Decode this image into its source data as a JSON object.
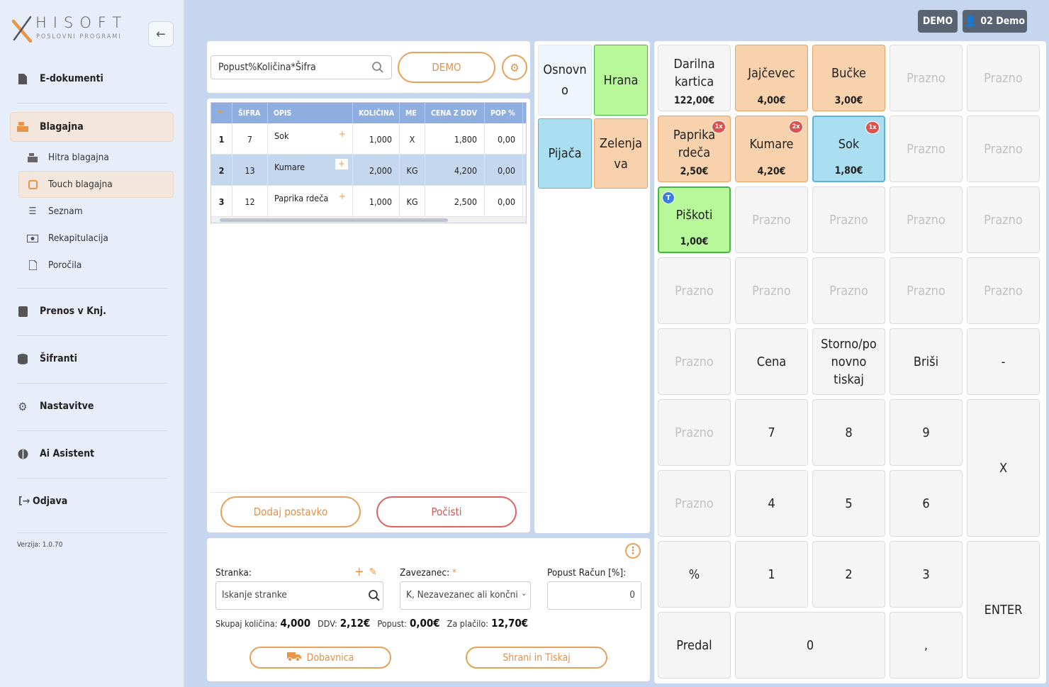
{
  "brand": {
    "name": "HISOFT",
    "tagline": "POSLOVNI PROGRAMI",
    "x_color": "#e8944a"
  },
  "topbar": {
    "env_badge": "DEMO",
    "user": "02 Demo"
  },
  "sidebar": {
    "items": [
      {
        "label": "E-dokumenti",
        "icon": "document-icon"
      },
      {
        "label": "Blagajna",
        "icon": "cash-register-icon",
        "active": true
      },
      {
        "label": "Prenos v Knj.",
        "icon": "book-icon"
      },
      {
        "label": "Šifranti",
        "icon": "database-icon"
      },
      {
        "label": "Nastavitve",
        "icon": "gear-icon"
      },
      {
        "label": "Ai Asistent",
        "icon": "brain-icon"
      },
      {
        "label": "Odjava",
        "icon": "logout-icon"
      }
    ],
    "subitems": [
      {
        "label": "Hitra blagajna",
        "icon": "register-icon"
      },
      {
        "label": "Touch blagajna",
        "icon": "tablet-icon",
        "active": true
      },
      {
        "label": "Seznam",
        "icon": "list-icon"
      },
      {
        "label": "Rekapitulacija",
        "icon": "money-icon"
      },
      {
        "label": "Poročila",
        "icon": "report-icon"
      }
    ],
    "version": "Verzija: 1.0.70"
  },
  "entry": {
    "placeholder": "Popust%Količina*Šifra",
    "demo_button": "DEMO"
  },
  "table": {
    "columns": [
      "*",
      "ŠIFRA",
      "OPIS",
      "KOLIČINA",
      "ME",
      "CENA Z DDV",
      "POP %"
    ],
    "rows": [
      {
        "n": "1",
        "code": "7",
        "desc": "Sok",
        "qty": "1,000",
        "unit": "X",
        "price": "1,800",
        "disc": "0,00"
      },
      {
        "n": "2",
        "code": "13",
        "desc": "Kumare",
        "qty": "2,000",
        "unit": "KG",
        "price": "4,200",
        "disc": "0,00"
      },
      {
        "n": "3",
        "code": "12",
        "desc": "Paprika rdeča",
        "qty": "1,000",
        "unit": "KG",
        "price": "2,500",
        "disc": "0,00"
      }
    ],
    "add_button": "Dodaj postavko",
    "clear_button": "Počisti"
  },
  "customer": {
    "label": "Stranka:",
    "search_placeholder": "Iskanje stranke",
    "taxpayer_label": "Zavezanec:",
    "required_mark": "*",
    "taxpayer_value": "K, Nezavezanec ali končni",
    "discount_label": "Popust Račun [%]:",
    "discount_value": "0"
  },
  "totals": {
    "qty_label": "Skupaj količina:",
    "qty": "4,000",
    "vat_label": "DDV:",
    "vat": "2,12€",
    "disc_label": "Popust:",
    "disc": "0,00€",
    "pay_label": "Za plačilo:",
    "pay": "12,70€"
  },
  "actions": {
    "delivery": "Dobavnica",
    "save_print": "Shrani in Tiskaj"
  },
  "categories": [
    {
      "label": "Osnovno",
      "line1": "Osnovn",
      "line2": "o",
      "color": "#eef5fd"
    },
    {
      "label": "Hrana",
      "line1": "Hrana",
      "line2": "",
      "color": "#b8f79a"
    },
    {
      "label": "Pijača",
      "line1": "Pijača",
      "line2": "",
      "color": "#a9dff0"
    },
    {
      "label": "Zelenjava",
      "line1": "Zelenja",
      "line2": "va",
      "color": "#f8d2ac"
    }
  ],
  "products": [
    {
      "l1": "Darilna",
      "l2": "kartica",
      "price": "122,00€"
    },
    {
      "l1": "Jajčevec",
      "l2": "",
      "price": "4,00€"
    },
    {
      "l1": "Bučke",
      "l2": "",
      "price": "3,00€"
    },
    {
      "l1": "Paprika",
      "l2": "rdeča",
      "price": "2,50€",
      "badge": "1x"
    },
    {
      "l1": "Kumare",
      "l2": "",
      "price": "4,20€",
      "badge": "2x"
    },
    {
      "l1": "Sok",
      "l2": "",
      "price": "1,80€",
      "badge": "1x"
    },
    {
      "l1": "Piškoti",
      "l2": "",
      "price": "1,00€",
      "tag": "T"
    }
  ],
  "empty_label": "Prazno",
  "keys": {
    "price": "Cena",
    "storno_1": "Storno/po",
    "storno_2": "novno",
    "storno_3": "tiskaj",
    "delete": "Briši",
    "minus": "-",
    "multiply": "X",
    "enter": "ENTER",
    "percent": "%",
    "drawer": "Predal",
    "comma": ",",
    "d0": "0",
    "d1": "1",
    "d2": "2",
    "d3": "3",
    "d4": "4",
    "d5": "5",
    "d6": "6",
    "d7": "7",
    "d8": "8",
    "d9": "9"
  }
}
